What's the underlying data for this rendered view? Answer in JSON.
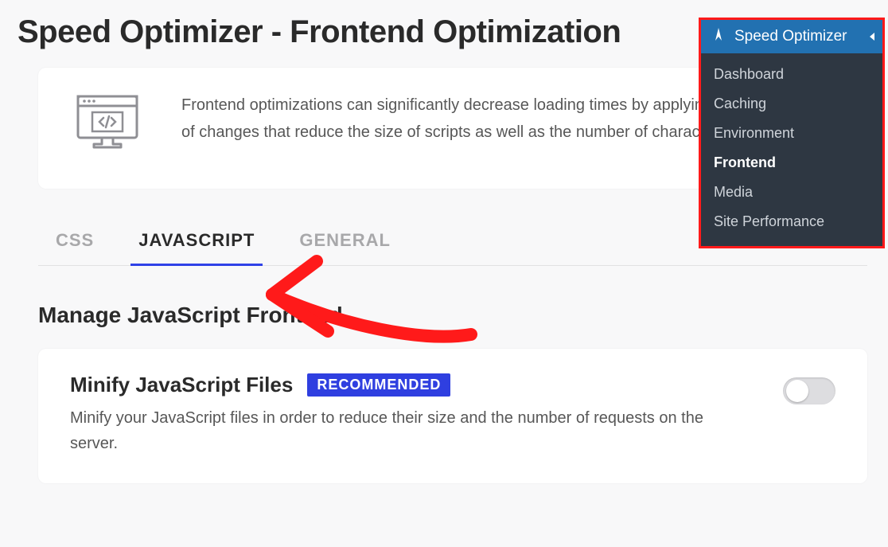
{
  "page": {
    "title": "Speed Optimizer - Frontend Optimization"
  },
  "intro": {
    "text": "Frontend optimizations can significantly decrease loading times by applying a variety of changes that reduce the size of scripts as well as the number of characters used."
  },
  "tabs": {
    "items": [
      {
        "label": "CSS",
        "active": false
      },
      {
        "label": "JAVASCRIPT",
        "active": true
      },
      {
        "label": "GENERAL",
        "active": false
      }
    ]
  },
  "section": {
    "title": "Manage JavaScript Frontend"
  },
  "setting": {
    "title": "Minify JavaScript Files",
    "badge": "RECOMMENDED",
    "description": "Minify your JavaScript files in order to reduce their size and the number of requests on the server.",
    "enabled": false
  },
  "flyout": {
    "title": "Speed Optimizer",
    "items": [
      {
        "label": "Dashboard",
        "current": false
      },
      {
        "label": "Caching",
        "current": false
      },
      {
        "label": "Environment",
        "current": false
      },
      {
        "label": "Frontend",
        "current": true
      },
      {
        "label": "Media",
        "current": false
      },
      {
        "label": "Site Performance",
        "current": false
      }
    ]
  }
}
